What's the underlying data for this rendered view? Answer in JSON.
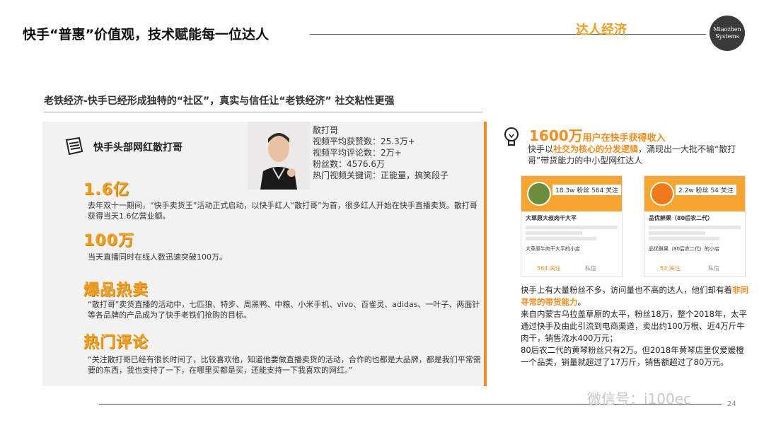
{
  "header": {
    "title": "快手“普惠”价值观，技术赋能每一位达人",
    "section_tag": "达人经济",
    "logo_text": "Miaozhen Systems"
  },
  "subtitle": "老铁经济-快手已经形成独特的“社区”，真实与信任让“老铁经济” 社交粘性更强",
  "left": {
    "heading": "快手头部网红散打哥",
    "profile": {
      "name": "散打哥",
      "likes": "视频平均获赞数：25.3万+",
      "comments": "视频平均评论数：2万+",
      "fans": "粉丝数：4576.6万",
      "keywords": "热门视频关键词：正能量，搞笑段子"
    },
    "sections": [
      {
        "heading": "1.6亿",
        "text": "去年双十一期间，“快手卖货王”活动正式启动，以快手红人“散打哥”为首，很多红人开始在快手直播卖货。散打哥获得当天1.6亿营业额。"
      },
      {
        "heading": "100万",
        "text": "当天直播同时在线人数迅速突破100万。"
      },
      {
        "heading": "爆品热卖",
        "text": "“散打哥”卖货直播的活动中，七匹狼、特步、周黑鸭、中粮、小米手机、vivo、百雀灵、adidas、一叶子、两面针等各品牌的产品成为了快手老铁们抢购的目标。"
      },
      {
        "heading": "热门评论",
        "text": "“关注散打哥已经有很长时间了，比较喜欢他，知道他要做直播卖货的活动，合作的也都是大品牌，都是我们平常需要的东西，我也支持了一下，在哪里买都是买，还能支持一下我喜欢的网红。”"
      }
    ]
  },
  "right": {
    "head_num": "1600万",
    "head_text": "用户在快手获得收入",
    "desc_a": "快手以",
    "desc_hl": "社交为核心的分发逻辑",
    "desc_b": "，涌现出一大批不输“散打哥”带货能力的中小型网红达人",
    "phones": [
      {
        "stats": "18.3w 粉丝  564 关注",
        "name": "大草原大叔肉干大平",
        "shop": "大草原牛肉干大平的小店",
        "btn_a": "564 关注",
        "btn_b": "私信"
      },
      {
        "stats": "2.2w 粉丝  54 关注",
        "name": "品优鲜果（80后农二代）",
        "shop": "品优鲜果（80后农二代）的小店",
        "btn_a": "54 关注",
        "btn_b": "私信"
      }
    ],
    "body_a": "快手上有大量粉丝不多，访问量也不高的达人，他们却有着",
    "body_hl": "非同寻常的带货能力",
    "body_b": "。",
    "body_p2": "来自内蒙古乌拉盖草原的太平，粉丝18万，整个2018年，太平通过快手及由此引流到电商渠道，卖出约100万根、近4万斤牛肉干，销售流水400万元；",
    "body_p3": "80后农二代的黄琴粉丝只有2万。但2018年黄琴店里仅爱媛橙一个品类，销量就超过了17万斤，销售额超过了80万元。"
  },
  "footer": {
    "watermark": "微信号：i100ec",
    "page": "24"
  }
}
